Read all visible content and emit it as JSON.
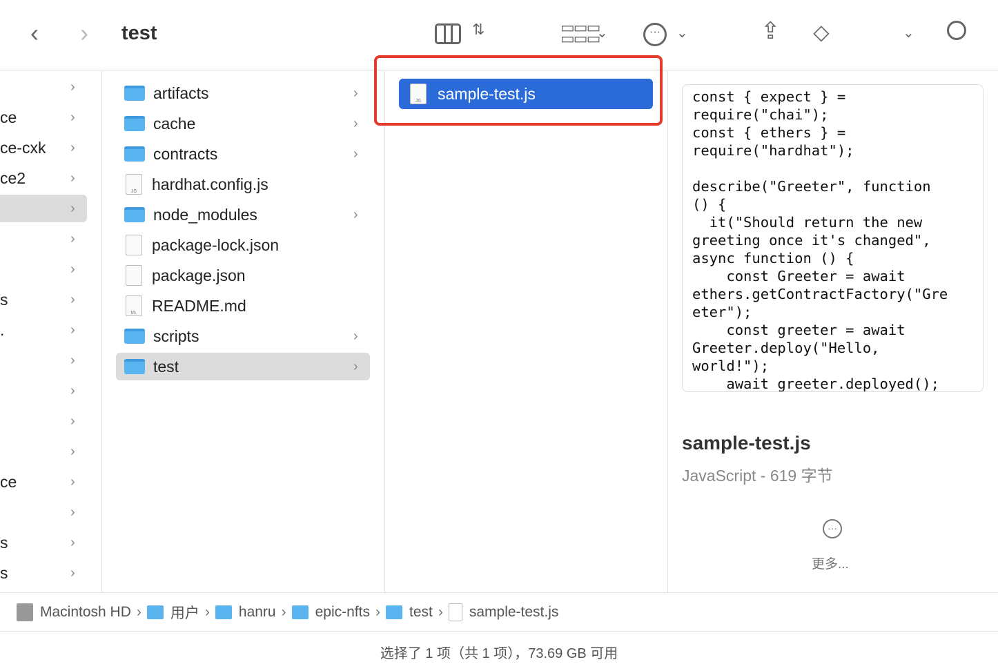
{
  "toolbar": {
    "title": "test",
    "icons": [
      "chevron-left",
      "chevron-right",
      "columns-view",
      "group-grid",
      "more-circle",
      "share",
      "tag",
      "chevron-down",
      "search"
    ]
  },
  "sidebar": {
    "items": [
      "",
      "ce",
      "ce-cxk",
      "ce2",
      "",
      "",
      "",
      "s",
      ".",
      "",
      "",
      "",
      "",
      "ce",
      "",
      "s",
      "s"
    ],
    "selected_index": 4
  },
  "column1": {
    "items": [
      {
        "name": "artifacts",
        "type": "folder"
      },
      {
        "name": "cache",
        "type": "folder"
      },
      {
        "name": "contracts",
        "type": "folder"
      },
      {
        "name": "hardhat.config.js",
        "type": "js"
      },
      {
        "name": "node_modules",
        "type": "folder"
      },
      {
        "name": "package-lock.json",
        "type": "json"
      },
      {
        "name": "package.json",
        "type": "json"
      },
      {
        "name": "README.md",
        "type": "md"
      },
      {
        "name": "scripts",
        "type": "folder"
      },
      {
        "name": "test",
        "type": "folder",
        "selected": true
      }
    ]
  },
  "column2": {
    "selected_file": "sample-test.js",
    "highlight_color": "#e53b2c",
    "selection_color": "#2b6bd9"
  },
  "preview": {
    "code": "const { expect } =\nrequire(\"chai\");\nconst { ethers } =\nrequire(\"hardhat\");\n\ndescribe(\"Greeter\", function\n() {\n  it(\"Should return the new\ngreeting once it's changed\",\nasync function () {\n    const Greeter = await\nethers.getContractFactory(\"Gre\neter\");\n    const greeter = await\nGreeter.deploy(\"Hello,\nworld!\");\n    await greeter.deployed();",
    "filename": "sample-test.js",
    "kind": "JavaScript - 619 字节",
    "more": "更多..."
  },
  "pathbar": [
    "Macintosh HD",
    "用户",
    "hanru",
    "epic-nfts",
    "test",
    "sample-test.js"
  ],
  "status": "选择了 1 项（共 1 项），73.69 GB 可用"
}
